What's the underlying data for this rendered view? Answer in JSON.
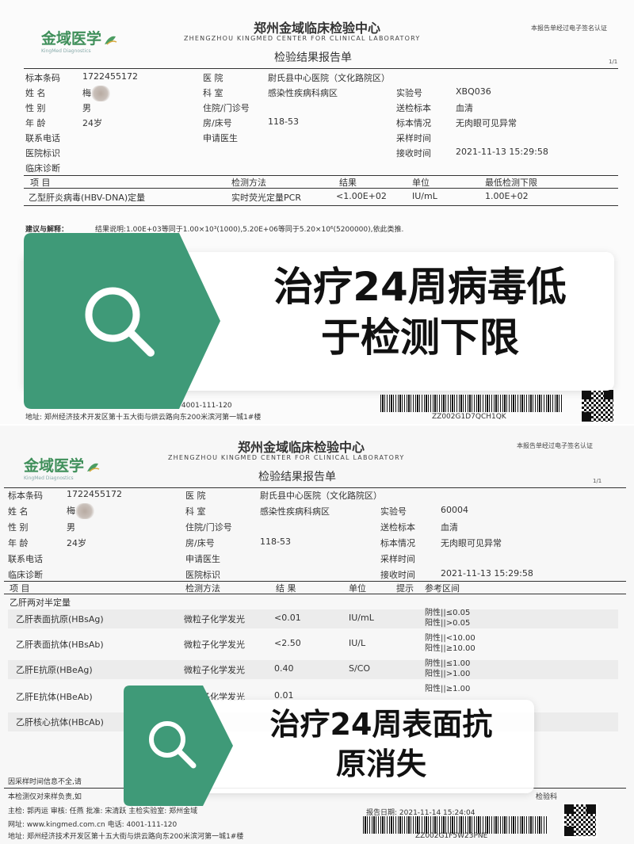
{
  "report1": {
    "org_cn": "郑州金域临床检验中心",
    "org_en": "ZHENGZHOU KINGMED CENTER FOR CLINICAL LABORATORY",
    "logo": "金域医学",
    "logo_sub": "KingMed Diagnostics",
    "report_title": "检验结果报告单",
    "sig_note": "本报告单经过电子签名认证",
    "page": "1/1",
    "fields": {
      "barcode_label": "标本条码",
      "barcode_value": "1722455172",
      "name_label": "姓  名",
      "name_value": "梅",
      "sex_label": "性  别",
      "sex_value": "男",
      "age_label": "年  龄",
      "age_value": "24岁",
      "phone_label": "联系电话",
      "hosp_id_label": "医院标识",
      "diag_label": "临床诊断",
      "hospital_label": "医  院",
      "hospital_value": "尉氏县中心医院（文化路院区）",
      "dept_label": "科  室",
      "dept_value": "感染性疾病科病区",
      "inpatient_label": "住院/门诊号",
      "bed_label": "房/床号",
      "bed_value": "118-53",
      "doctor_label": "申请医生",
      "labno_label": "实验号",
      "labno_value": "XBQ036",
      "sample_label": "送检标本",
      "sample_value": "血清",
      "condition_label": "标本情况",
      "condition_value": "无肉眼可见异常",
      "collect_label": "采样时间",
      "receive_label": "接收时间",
      "receive_value": "2021-11-13  15:29:58"
    },
    "table_headers": [
      "项      目",
      "检测方法",
      "结果",
      "单位",
      "最低检测下限"
    ],
    "row": {
      "item": "乙型肝炎病毒(HBV-DNA)定量",
      "method": "实时荧光定量PCR",
      "result": "<1.00E+02",
      "unit": "IU/mL",
      "limit": "1.00E+02"
    },
    "advice_label": "建议与解释：",
    "advice_text": "结果说明:1.00E+03等同于1.00×10³(1000),5.20E+06等同于5.20×10⁶(5200000),依此类推.",
    "phone_footer": "电话: 4001-111-120",
    "address_footer": "地址:  郑州经济技术开发区第十五大街与烘云路向东200米滨河第一城1#楼",
    "barcode_code": "ZZ002G1D7QCH1QK",
    "overlay_line1": "治疗24周病毒低",
    "overlay_line2": "于检测下限"
  },
  "report2": {
    "org_cn": "郑州金域临床检验中心",
    "org_en": "ZHENGZHOU KINGMED CENTER FOR CLINICAL LABORATORY",
    "logo": "金域医学",
    "logo_sub": "KingMed Diagnostics",
    "report_title": "检验结果报告单",
    "sig_note": "本报告单经过电子签名认证",
    "page": "1/1",
    "fields": {
      "barcode_label": "标本条码",
      "barcode_value": "1722455172",
      "name_label": "姓  名",
      "name_value": "梅",
      "sex_label": "性  别",
      "sex_value": "男",
      "age_label": "年  龄",
      "age_value": "24岁",
      "phone_label": "联系电话",
      "diag_label": "临床诊断",
      "hospital_label": "医  院",
      "hospital_value": "尉氏县中心医院（文化路院区）",
      "dept_label": "科  室",
      "dept_value": "感染性疾病科病区",
      "inpatient_label": "住院/门诊号",
      "bed_label": "房/床号",
      "bed_value": "118-53",
      "doctor_label": "申请医生",
      "hosp_id_label": "医院标识",
      "labno_label": "实验号",
      "labno_value": "60004",
      "sample_label": "送检标本",
      "sample_value": "血清",
      "condition_label": "标本情况",
      "condition_value": "无肉眼可见异常",
      "collect_label": "采样时间",
      "receive_label": "接收时间",
      "receive_value": "2021-11-13  15:29:58"
    },
    "table_headers": [
      "项      目",
      "检测方法",
      "结      果",
      "单位",
      "提示",
      "参考区间"
    ],
    "group_title": "乙肝两对半定量",
    "rows": [
      {
        "item": "乙肝表面抗原(HBsAg)",
        "method": "微粒子化学发光",
        "result": "<0.01",
        "unit": "IU/mL",
        "ref1": "阴性||≤0.05",
        "ref2": "阳性||>0.05"
      },
      {
        "item": "乙肝表面抗体(HBsAb)",
        "method": "微粒子化学发光",
        "result": "<2.50",
        "unit": "IU/L",
        "ref1": "阴性||<10.00",
        "ref2": "阳性||≥10.00"
      },
      {
        "item": "乙肝E抗原(HBeAg)",
        "method": "微粒子化学发光",
        "result": "0.40",
        "unit": "S/CO",
        "ref1": "阴性||≤1.00",
        "ref2": "阳性||>1.00"
      },
      {
        "item": "乙肝E抗体(HBeAb)",
        "method": "微粒子化学发光",
        "result": "0.01",
        "unit": "",
        "ref1": "阳性||≥1.00",
        "ref2": ""
      },
      {
        "item": "乙肝核心抗体(HBcAb)",
        "method": "",
        "result": "",
        "unit": "",
        "ref1": "",
        "ref2": ""
      }
    ],
    "footer_note1": "因采样时间信息不全,请",
    "footer_note2": "本检测仅对来样负责,如",
    "footer_note2_right": "检验科",
    "signers": "主检: 郭丙运  审核: 任燕  批准: 宋清跃  主检实验室: 郑州金域",
    "report_date": "报告日期: 2021-11-14  15:24:04",
    "website": "网址:  www.kingmed.com.cn    电话: 4001-111-120",
    "address": "地址:  郑州经济技术开发区第十五大街与烘云路向东200米滨河第一城1#楼",
    "barcode_code": "ZZ002G1F5W23PNE",
    "overlay_line1": "治疗24周表面抗",
    "overlay_line2": "原消失"
  }
}
